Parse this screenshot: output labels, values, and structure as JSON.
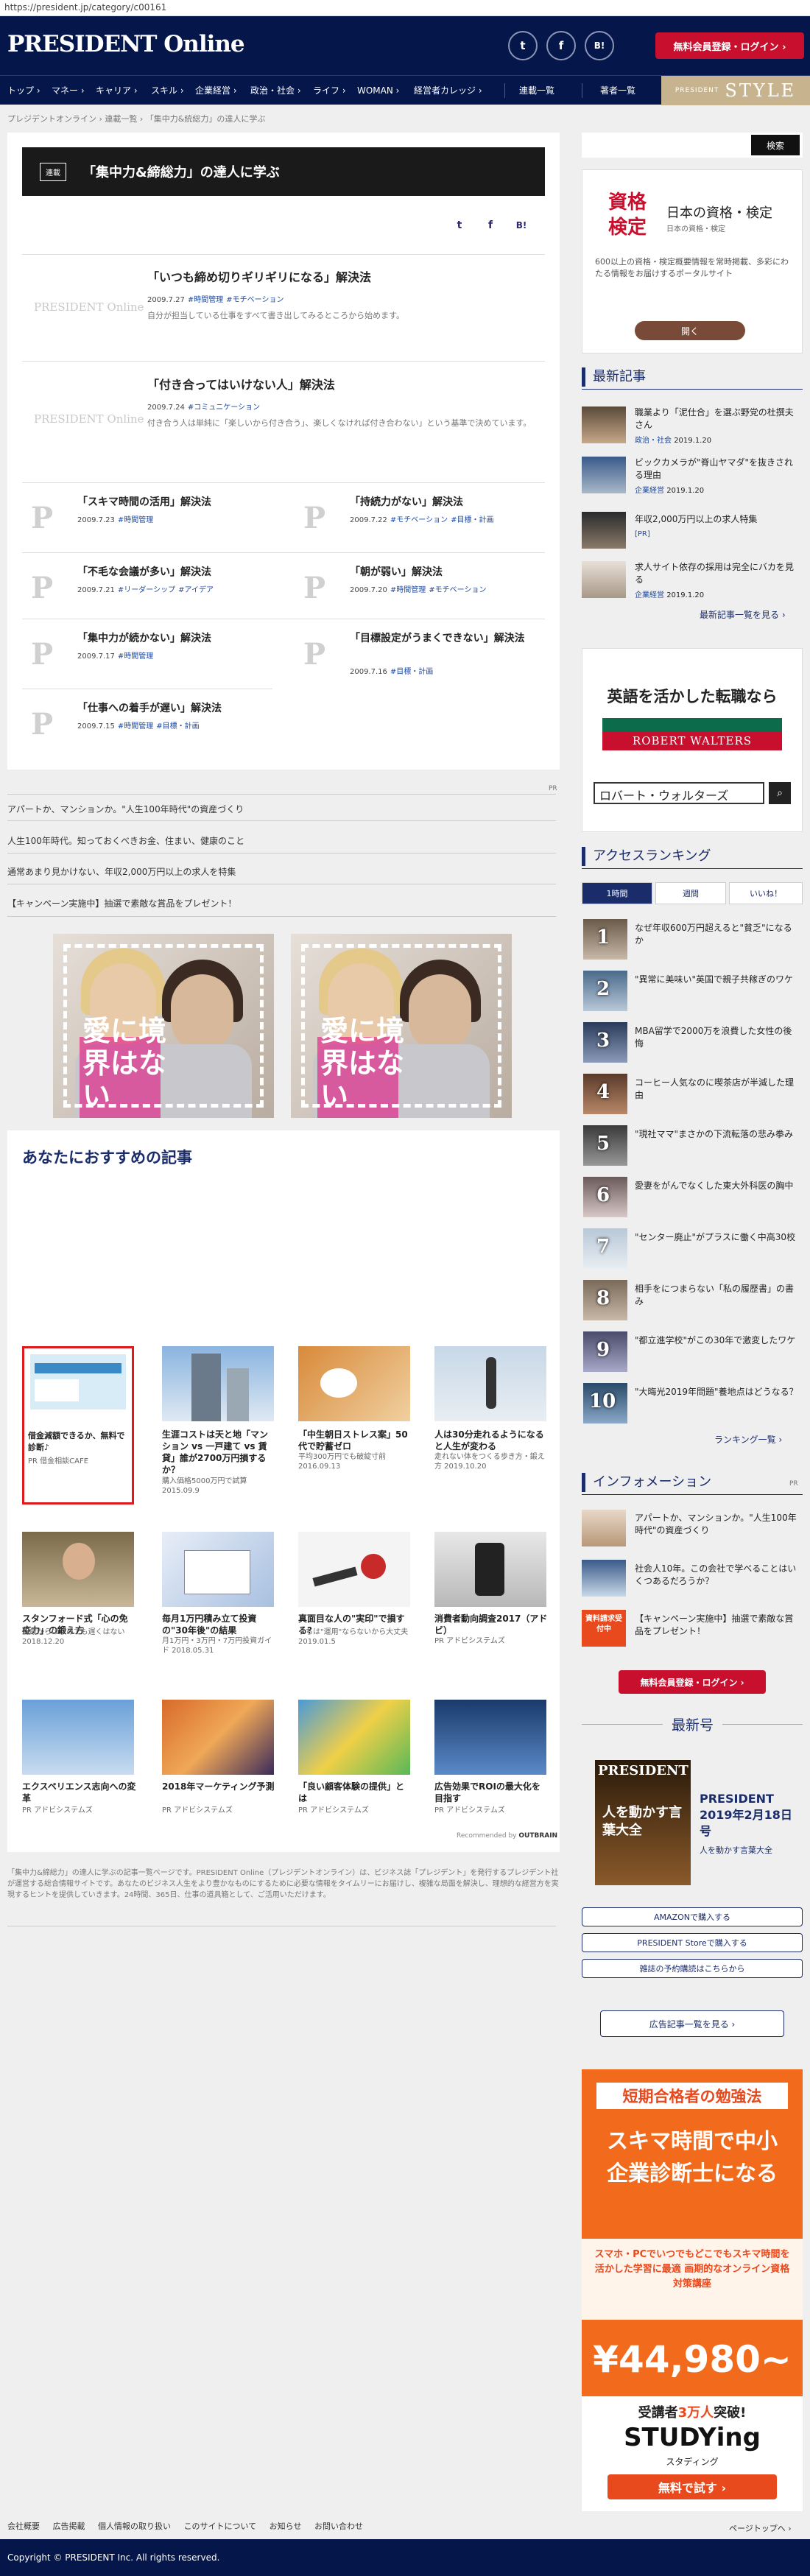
{
  "url": "https://president.jp/category/c00161",
  "header": {
    "logo": "PRESIDENT Online",
    "social": [
      "twitter-icon",
      "facebook-icon",
      "hatena-icon"
    ],
    "social_labels": {
      "twitter": "t",
      "facebook": "f",
      "hatena": "B!"
    },
    "register_login": "無料会員登録・ログイン ›"
  },
  "nav": {
    "items": [
      "トップ ›",
      "マネー ›",
      "キャリア ›",
      "スキル ›",
      "企業経営 ›",
      "政治・社会 ›",
      "ライフ ›",
      "WOMAN ›",
      "経営者カレッジ ›"
    ],
    "serial": "連載一覧",
    "authors": "著者一覧",
    "style_small": "PRESIDENT",
    "style": "STYLE"
  },
  "breadcrumb": "プレジデントオンライン › 連載一覧 › 「集中力&統総力」の達人に学ぶ",
  "series": {
    "badge": "連載",
    "title": "「集中力&締総力」の達人に学ぶ"
  },
  "articles_main": [
    {
      "title": "「いつも締め切りギリギリになる」解決法",
      "date": "2009.7.27",
      "tags": [
        "#時間管理",
        "#モチベーション"
      ],
      "desc": "自分が担当している仕事をすべて書き出してみるところから始めます。",
      "thumb": "PRESIDENT Online"
    },
    {
      "title": "「付き合ってはいけない人」解決法",
      "date": "2009.7.24",
      "tags": [
        "#コミュニケーション"
      ],
      "desc": "付き合う人は単純に「楽しいから付き合う」、楽しくなければ付き合わない」という基準で決めています。",
      "thumb": "PRESIDENT Online"
    }
  ],
  "articles_grid": [
    {
      "title": "「スキマ時間の活用」解決法",
      "date": "2009.7.23",
      "tags": [
        "#時間管理"
      ]
    },
    {
      "title": "「持続力がない」解決法",
      "date": "2009.7.22",
      "tags": [
        "#モチベーション",
        "#目標・計画"
      ]
    },
    {
      "title": "「不毛な会議が多い」解決法",
      "date": "2009.7.21",
      "tags": [
        "#リーダーシップ",
        "#アイデア"
      ]
    },
    {
      "title": "「朝が弱い」解決法",
      "date": "2009.7.20",
      "tags": [
        "#時間管理",
        "#モチベーション"
      ]
    },
    {
      "title": "「集中力が続かない」解決法",
      "date": "2009.7.17",
      "tags": [
        "#時間管理"
      ]
    },
    {
      "title": "「目標設定がうまくできない」解決法",
      "date": "2009.7.16",
      "tags": [
        "#目標・計画"
      ]
    },
    {
      "title": "「仕事への着手が遅い」解決法",
      "date": "2009.7.15",
      "tags": [
        "#時間管理",
        "#目標・計画"
      ]
    }
  ],
  "pr": {
    "label": "PR",
    "links": [
      "アパートか、マンションか。\"人生100年時代\"の資産づくり",
      "人生100年時代。知っておくべきお金、住まい、健康のこと",
      "通常あまり見かけない、年収2,000万円以上の求人を特集",
      "【キャンペーン実施中】抽選で素敵な賞品をプレゼント！"
    ]
  },
  "ad_photo_text": "愛に境界はない",
  "recommend": {
    "heading": "あなたにおすすめの記事",
    "cards": [
      {
        "title": "借金減額できるか、無料で診断♪",
        "sub": "PR 借金相談CAFE",
        "img": "ad"
      },
      {
        "title": "生涯コストは天と地「マンション vs 一戸建て vs 賃貸」誰が2700万円損するか？",
        "sub": "購入価格5000万円で試算 2015.09.9",
        "img": "building"
      },
      {
        "title": "「中生朝日ストレス案」50代で貯蓄ゼロ",
        "sub": "平均300万円でも破綻寸前 2016.09.13",
        "img": "food"
      },
      {
        "title": "人は30分走れるようになると人生が変わる",
        "sub": "走れない体をつくる歩き方・鍛え方 2019.10.20",
        "img": "runner"
      },
      {
        "title": "スタンフォード式「心の免疫力」の鍛え方",
        "sub": "何歳からはじめても遅くはない 2018.12.20",
        "img": "portrait"
      },
      {
        "title": "毎月1万円積み立て投資の\"30年後\"の結果",
        "sub": "月1万円・3万円・7万円投資ガイド 2018.05.31",
        "img": "calc"
      },
      {
        "title": "真面目な人の\"実印\"で損する?",
        "sub": "うちは\"運用\"ならないから大丈夫 2019.01.5",
        "img": "stamp"
      },
      {
        "title": "消費者動向調査2017（アドビ）",
        "sub": "PR アドビシステムズ",
        "img": "phone"
      },
      {
        "title": "エクスペリエンス志向への変革",
        "sub": "PR アドビシステムズ",
        "img": "people"
      },
      {
        "title": "2018年マーケティング予測",
        "sub": "PR アドビシステムズ",
        "img": "abstract"
      },
      {
        "title": "「良い顧客体験の提供」とは",
        "sub": "PR アドビシステムズ",
        "img": "hands"
      },
      {
        "title": "広告効果でROIの最大化を目指す",
        "sub": "PR アドビシステムズ",
        "img": "city"
      }
    ],
    "powered": "Recommended by",
    "powered_brand": "OUTBRAIN"
  },
  "bottom_desc": "「集中力&締総力」の達人に学ぶの記事一覧ページです。PRESIDENT Online（プレジデントオンライン）は、ビジネス誌「プレジデント」を発行するプレジデント社が運営する総合情報サイトです。あなたのビジネス人生をより豊かなものにするために必要な情報をタイムリーにお届けし、複雑な局面を解決し、理想的な経営方を実現するヒントを提供していきます。24時間、365日、仕事の道具箱として、ご活用いただけます。",
  "sidebar": {
    "search_button": "検索",
    "ad1": {
      "title1": "資格",
      "title2": "検定",
      "name": "日本の資格・検定",
      "sub": "日本の資格・検定",
      "desc": "600以上の資格・検定概要情報を常時掲載、多彩にわたる情報をお届けするポータルサイト",
      "button": "開く"
    },
    "latest_heading": "最新記事",
    "latest": [
      {
        "title": "職業より「泥仕合」を選ぶ野党の杜撰夫さん",
        "cat": "政治・社会",
        "date": "2019.1.20"
      },
      {
        "title": "ビックカメラが\"脊山ヤマダ\"を抜きされる理由",
        "cat": "企業経営",
        "date": "2019.1.20"
      },
      {
        "title": "年収2,000万円以上の求人特集",
        "cat": "[PR]",
        "date": ""
      },
      {
        "title": "求人サイト依存の採用は完全にバカを見る",
        "cat": "企業経営",
        "date": "2019.1.20"
      }
    ],
    "latest_more": "最新記事一覧を見る ›",
    "ad2": {
      "head": "英語を活かした転職なら",
      "brand": "ROBERT WALTERS",
      "search": "ロバート・ウォルターズ"
    },
    "ranking_heading": "アクセスランキング",
    "ranking_tabs": [
      "1時間",
      "週間",
      "いいね！"
    ],
    "ranking": [
      {
        "rank": "1",
        "title": "なぜ年収600万円超えると\"貧乏\"になるか"
      },
      {
        "rank": "2",
        "title": "\"異常に美味い\"英国で親子共稼ぎのワケ"
      },
      {
        "rank": "3",
        "title": "MBA留学で2000万を浪費した女性の後悔"
      },
      {
        "rank": "4",
        "title": "コーヒー人気なのに喫茶店が半減した理由"
      },
      {
        "rank": "5",
        "title": "\"現社ママ\"まさかの下流転落の悲み拳み"
      },
      {
        "rank": "6",
        "title": "愛妻をがんでなくした東大外科医の胸中"
      },
      {
        "rank": "7",
        "title": "\"センター廃止\"がプラスに働く中高30校"
      },
      {
        "rank": "8",
        "title": "相手をにつまらない「私の履歴書」の書み"
      },
      {
        "rank": "9",
        "title": "\"都立進学校\"がこの30年で激変したワケ"
      },
      {
        "rank": "10",
        "title": "\"大晦光2019年問題\"養地点はどうなる？"
      }
    ],
    "ranking_more": "ランキング一覧 ›",
    "info_heading": "インフォメーション",
    "info_pr": "PR",
    "info": [
      {
        "title": "アパートか、マンションか。\"人生100年時代\"の資産づくり"
      },
      {
        "title": "社会人10年。この会社で学べることはいくつあるだろうか？"
      },
      {
        "title": "【キャンペーン実施中】抽選で素敵な賞品をプレゼント！",
        "badge": "資料請求受付中"
      }
    ],
    "info_btn": "無料会員登録・ログイン ›",
    "latest_issue_heading": "最新号",
    "issue": {
      "mag": "PRESIDENT",
      "cover_text": "人を動かす言葉大全",
      "title": "PRESIDENT 2019年2月18日号",
      "subtitle": "人を動かす言葉大全"
    },
    "buy_buttons": [
      "AMAZONで購入する",
      "PRESIDENT Storeで購入する",
      "雑誌の予約購読はこちらから"
    ],
    "ads_list_btn": "広告記事一覧を見る ›",
    "ad3": {
      "head": "短期合格者の勉強法",
      "main": "スキマ時間で中小企業診断士になる",
      "sub": "スマホ・PCでいつでもどこでもスキマ時間を活かした学習に最適 画期的なオンライン資格対策講座",
      "price": "¥44,980~",
      "people_pre": "受講者",
      "people": "3万人",
      "people_post": "突破!",
      "brand": "STUDYing",
      "brand_sub": "スタディング",
      "cta": "無料で試す ›"
    }
  },
  "pagetop": "ページトップへ ›",
  "footer": {
    "links": [
      "会社概要",
      "広告掲載",
      "個人情報の取り扱い",
      "このサイトについて",
      "お知らせ",
      "お問い合わせ"
    ],
    "copyright": "Copyright © PRESIDENT Inc. All rights reserved."
  },
  "colors": {
    "navy": "#05174a",
    "red": "#c8102e",
    "tag": "#1e4aa0",
    "gold": "#c7b48f",
    "orange": "#f26b1d"
  }
}
